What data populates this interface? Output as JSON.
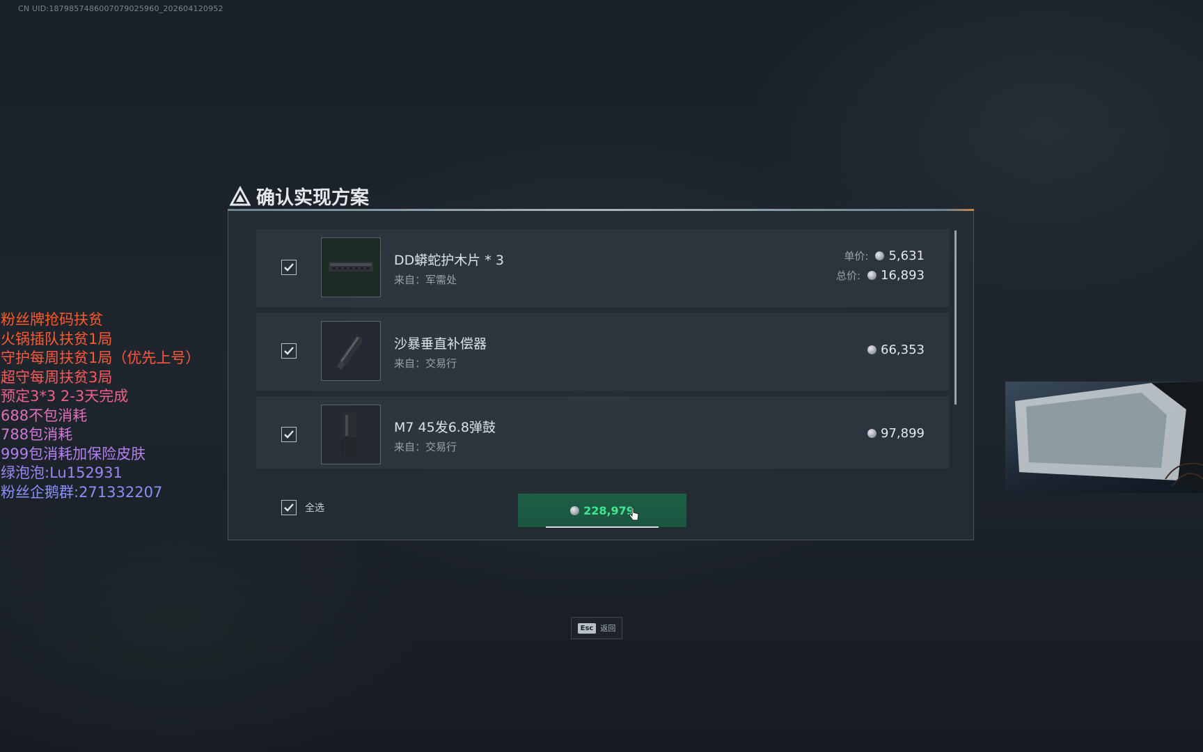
{
  "uid_text": "CN UID:1879857486007079025960_202604120952",
  "overlay_lines": [
    {
      "text": "粉丝牌抢码扶贫",
      "color": "#ff5a2a"
    },
    {
      "text": "火锅插队扶贫1局",
      "color": "#ff5a30"
    },
    {
      "text": "守护每周扶贫1局（优先上号）",
      "color": "#ff5840"
    },
    {
      "text": "超守每周扶贫3局",
      "color": "#ff5a5a"
    },
    {
      "text": "预定3*3 2-3天完成",
      "color": "#f0608a"
    },
    {
      "text": "688不包消耗",
      "color": "#e070b8"
    },
    {
      "text": "788包消耗",
      "color": "#d078d8"
    },
    {
      "text": "999包消耗加保险皮肤",
      "color": "#b380f0"
    },
    {
      "text": "绿泡泡:Lu152931",
      "color": "#9a86f6"
    },
    {
      "text": "粉丝企鹅群:271332207",
      "color": "#8a90fa"
    }
  ],
  "dialog": {
    "title": "确认实现方案",
    "items": [
      {
        "name": "DD蟒蛇护木片 * 3",
        "source": "来自：军需处",
        "unit_label": "单价:",
        "unit_price": "5,631",
        "total_label": "总价:",
        "total_price": "16,893",
        "checked": true,
        "thumb_icon": "handguard-icon"
      },
      {
        "name": "沙暴垂直补偿器",
        "source": "来自：交易行",
        "price": "66,353",
        "checked": true,
        "thumb_icon": "compensator-icon"
      },
      {
        "name": "M7 45发6.8弹鼓",
        "source": "来自：交易行",
        "price": "97,899",
        "checked": true,
        "thumb_icon": "magazine-icon"
      }
    ],
    "select_all_label": "全选",
    "confirm_total": "228,979",
    "colors": {
      "confirm_bg": "#1f6046",
      "confirm_text": "#3fe890",
      "accent": "#c7874a"
    }
  },
  "esc": {
    "key": "Esc",
    "label": "返回"
  }
}
